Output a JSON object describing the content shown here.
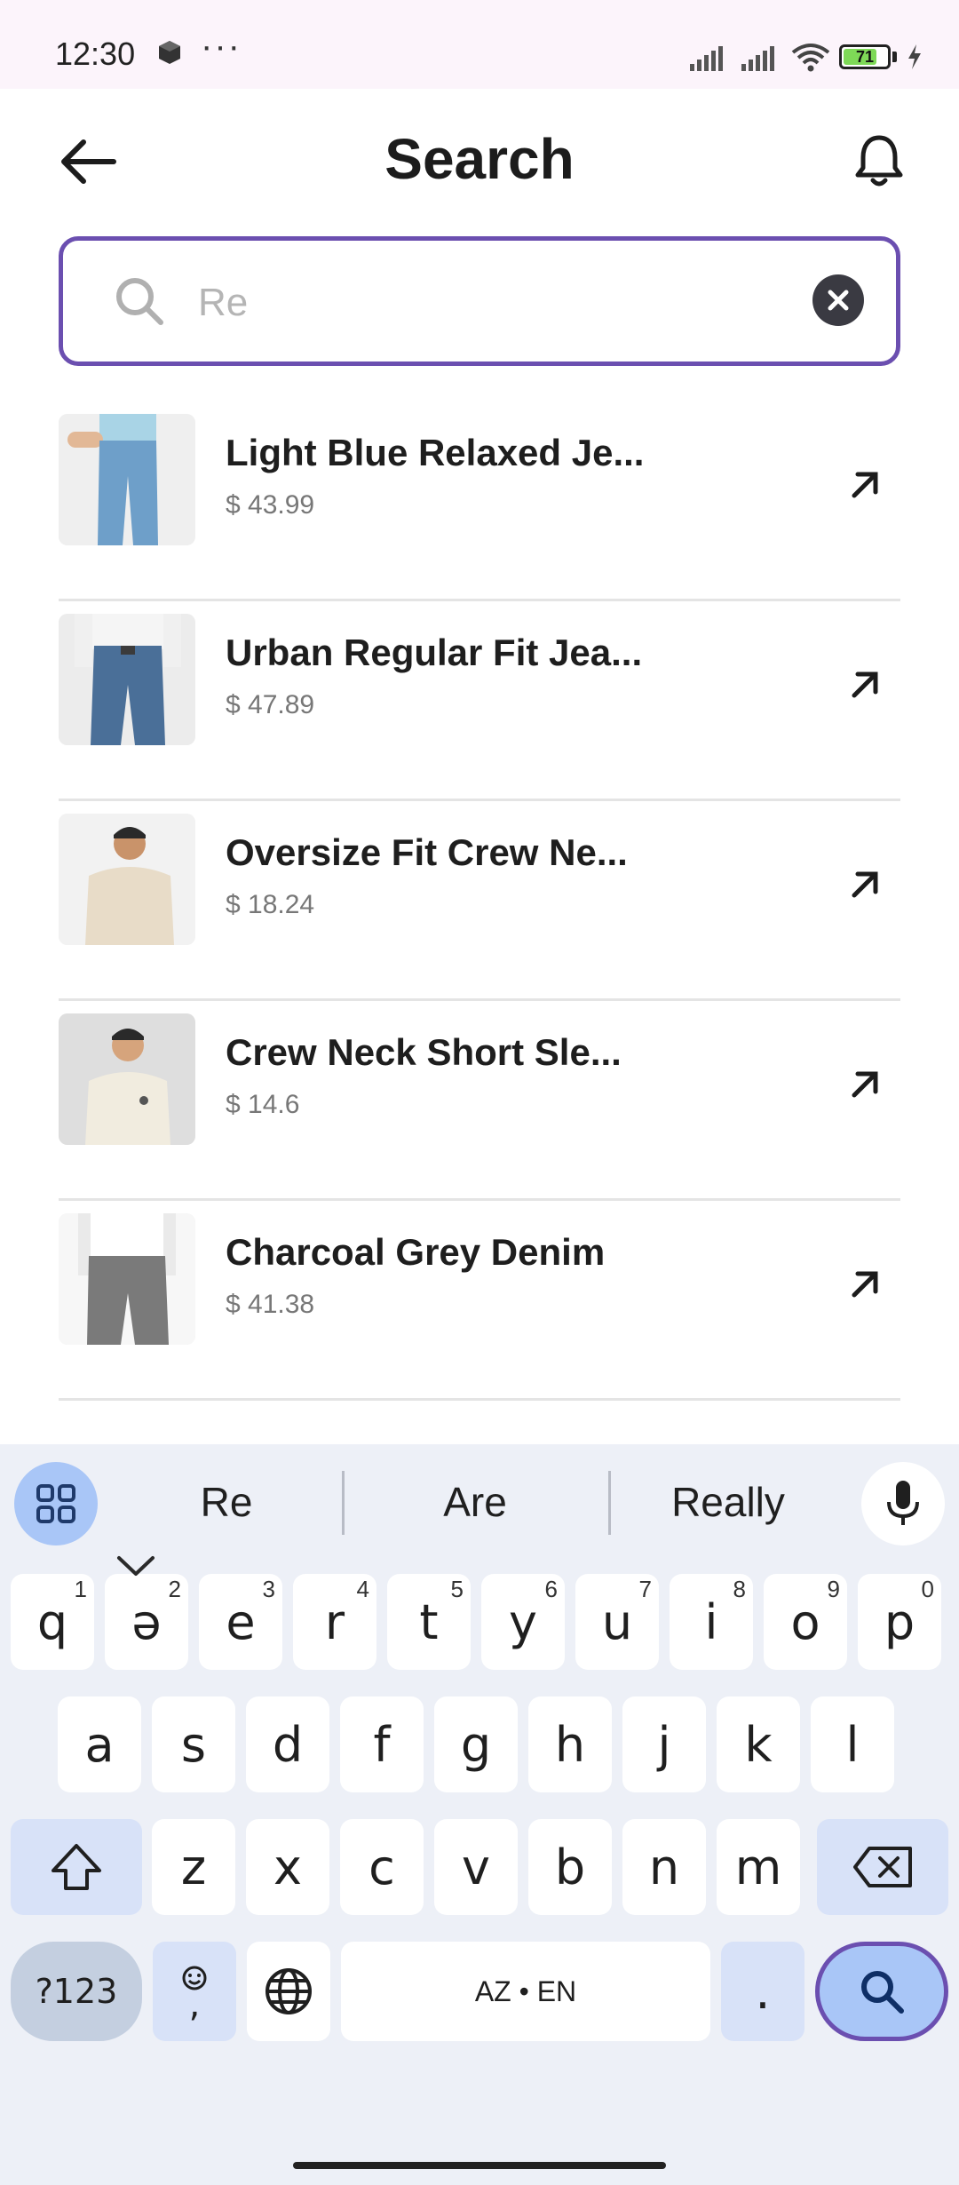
{
  "status_bar": {
    "time": "12:30",
    "battery": "71",
    "dots": "···"
  },
  "header": {
    "title": "Search"
  },
  "search": {
    "value": "Re",
    "placeholder": "Re"
  },
  "results": [
    {
      "title": "Light Blue Relaxed Je...",
      "price": "$ 43.99",
      "thumb": "light-jeans"
    },
    {
      "title": "Urban Regular Fit Jea...",
      "price": "$ 47.89",
      "thumb": "dark-jeans"
    },
    {
      "title": "Oversize Fit Crew Ne...",
      "price": "$ 18.24",
      "thumb": "beige-tee"
    },
    {
      "title": "Crew Neck Short Sle...",
      "price": "$ 14.6",
      "thumb": "cream-tee"
    },
    {
      "title": "Charcoal Grey Denim",
      "price": "$ 41.38",
      "thumb": "grey-denim"
    }
  ],
  "keyboard": {
    "suggestions": [
      "Re",
      "Are",
      "Really"
    ],
    "row1": [
      {
        "k": "q",
        "n": "1"
      },
      {
        "k": "ə",
        "n": "2"
      },
      {
        "k": "e",
        "n": "3"
      },
      {
        "k": "r",
        "n": "4"
      },
      {
        "k": "t",
        "n": "5"
      },
      {
        "k": "y",
        "n": "6"
      },
      {
        "k": "u",
        "n": "7"
      },
      {
        "k": "i",
        "n": "8"
      },
      {
        "k": "o",
        "n": "9"
      },
      {
        "k": "p",
        "n": "0"
      }
    ],
    "row2": [
      "a",
      "s",
      "d",
      "f",
      "g",
      "h",
      "j",
      "k",
      "l"
    ],
    "row3": [
      "z",
      "x",
      "c",
      "v",
      "b",
      "n",
      "m"
    ],
    "sym_label": "?123",
    "emoji_label": ",",
    "space_label": "AZ • EN",
    "period_label": "."
  }
}
